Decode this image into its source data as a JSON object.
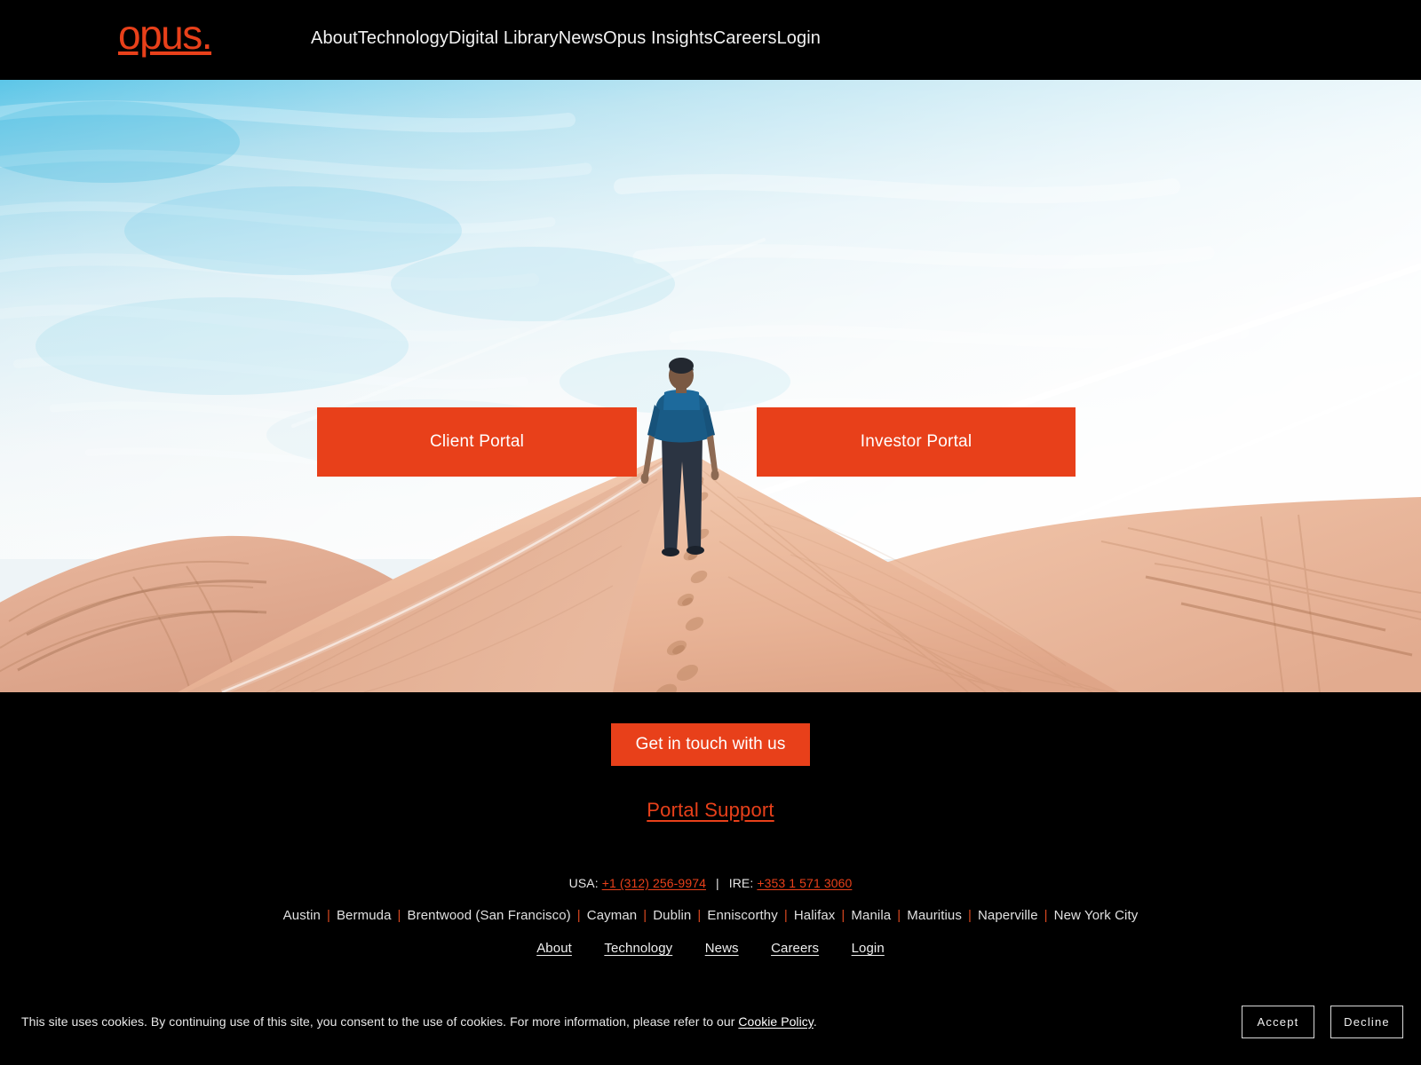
{
  "brand": {
    "logo_text": "opus.",
    "accent_color": "#e8401a"
  },
  "nav": {
    "items": [
      {
        "label": "About"
      },
      {
        "label": "Technology"
      },
      {
        "label": "Digital Library"
      },
      {
        "label": "News"
      },
      {
        "label": "Opus Insights"
      },
      {
        "label": "Careers"
      },
      {
        "label": "Login"
      }
    ]
  },
  "hero": {
    "image_description": "Person in blue shirt walking along a desert sand dune ridge with footprints, bright sky with contrails",
    "buttons": [
      {
        "label": "Client Portal"
      },
      {
        "label": "Investor Portal"
      }
    ]
  },
  "footer": {
    "cta_label": "Get in touch with us",
    "portal_support_label": "Portal Support",
    "contact": {
      "usa_label": "USA:",
      "usa_phone": "+1 (312) 256-9974",
      "separator": "|",
      "ire_label": "IRE:",
      "ire_phone": "+353 1 571 3060"
    },
    "cities": [
      "Austin",
      "Bermuda",
      "Brentwood (San Francisco)",
      "Cayman",
      "Dublin",
      "Enniscorthy",
      "Halifax",
      "Manila",
      "Mauritius",
      "Naperville",
      "New York City"
    ],
    "city_separator": "|",
    "links": [
      {
        "label": "About"
      },
      {
        "label": "Technology"
      },
      {
        "label": "News"
      },
      {
        "label": "Careers"
      },
      {
        "label": "Login"
      }
    ]
  },
  "cookie": {
    "text_before": "This site uses cookies.  By continuing use of this site, you consent to the use of cookies.  For more information, please refer to our ",
    "policy_link": "Cookie Policy",
    "text_after": ".",
    "accept_label": "Accept",
    "decline_label": "Decline"
  }
}
